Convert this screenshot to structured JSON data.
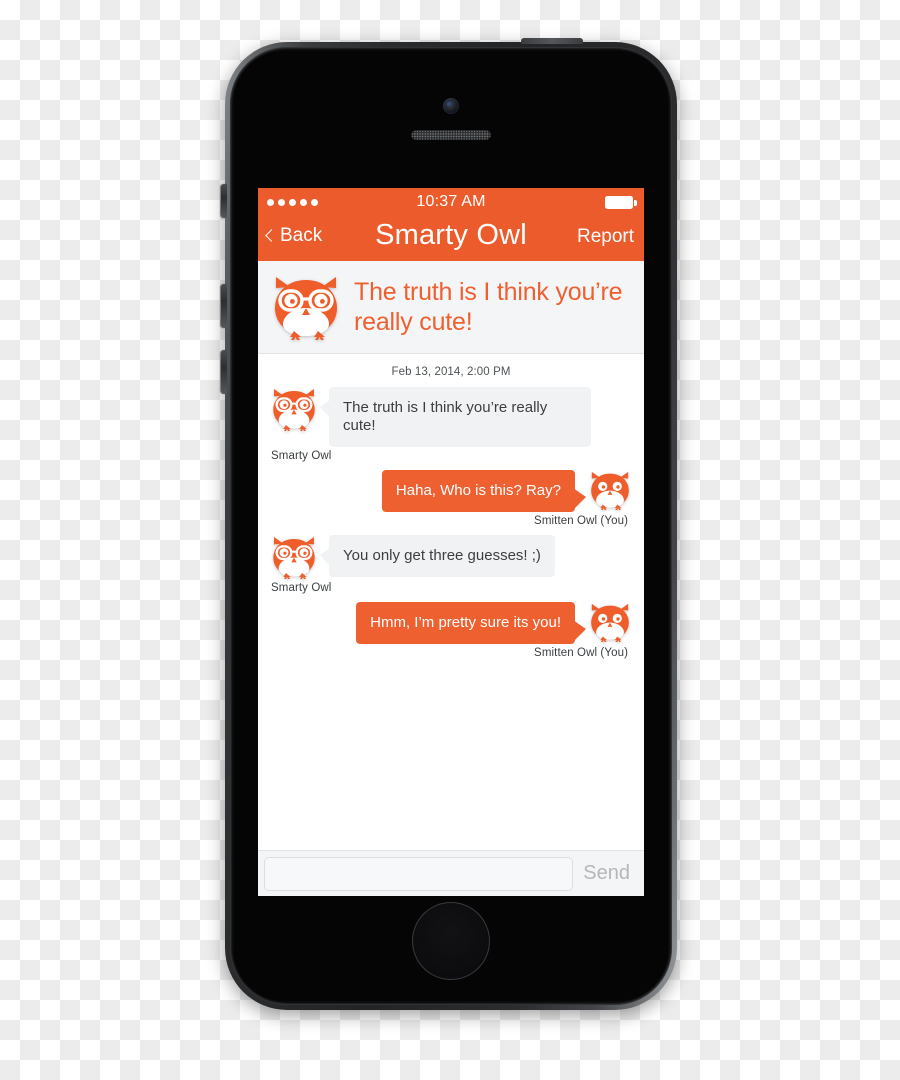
{
  "device": {
    "name": "smartphone-mockup",
    "hardware": {
      "camera": "front-camera",
      "speaker": "earpiece-speaker",
      "home_button": "home-button",
      "mute_switch": "mute-switch",
      "volume_up": "volume-up-button",
      "volume_down": "volume-down-button",
      "power": "power-button"
    }
  },
  "theme": {
    "accent": "#EC5B2B",
    "accent_text": "#EF6030",
    "incoming_bubble": "#F1F2F3",
    "banner_bg": "#F4F5F6",
    "text_dark": "#3B3F42",
    "send_disabled": "#B4B7BA"
  },
  "status_bar": {
    "signal_dots": 5,
    "time": "10:37 AM",
    "battery_icon": "battery-full-icon"
  },
  "nav": {
    "back_label": "Back",
    "back_icon": "chevron-left-icon",
    "title": "Smarty Owl",
    "report_label": "Report"
  },
  "banner": {
    "avatar_icon": "owl-avatar-glasses-icon",
    "headline": "The truth is I think you’re really cute!"
  },
  "conversation": {
    "date_separator": "Feb 13, 2014, 2:00 PM",
    "messages": [
      {
        "direction": "in",
        "avatar_icon": "owl-avatar-glasses-icon",
        "text": "The truth is I  think you’re really cute!",
        "sender": "Smarty Owl"
      },
      {
        "direction": "out",
        "avatar_icon": "owl-avatar-plain-icon",
        "text": "Haha, Who is this? Ray?",
        "sender": "Smitten  Owl (You)"
      },
      {
        "direction": "in",
        "avatar_icon": "owl-avatar-glasses-icon",
        "text": "You only get three guesses! ;)",
        "sender": "Smarty Owl"
      },
      {
        "direction": "out",
        "avatar_icon": "owl-avatar-plain-icon",
        "text": "Hmm, I’m pretty sure its you!",
        "sender": "Smitten  Owl (You)"
      }
    ]
  },
  "composer": {
    "value": "",
    "placeholder": "",
    "send_label": "Send"
  }
}
